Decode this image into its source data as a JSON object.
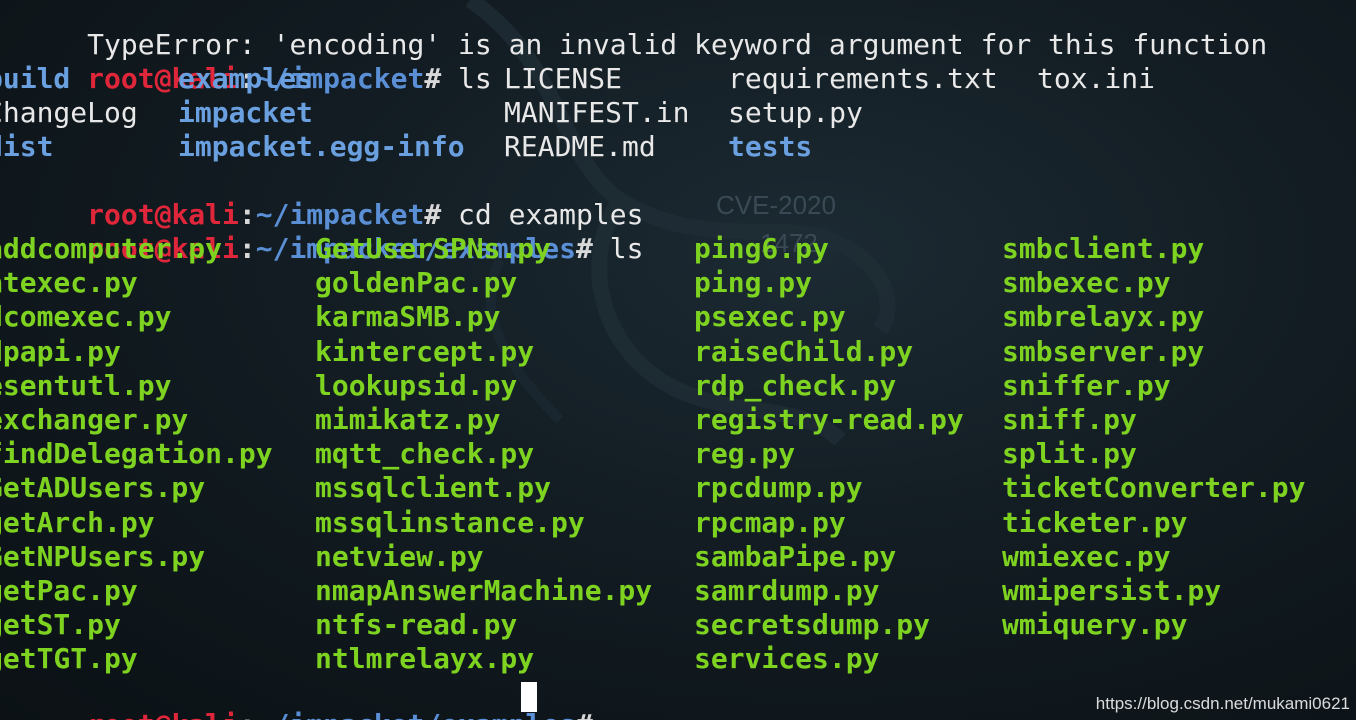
{
  "error_line": "TypeError: 'encoding' is an invalid keyword argument for this function",
  "prompt": {
    "user_host": "root@kali",
    "separator": ":",
    "path_home": "~/impacket",
    "path_examples": "~/impacket/examples",
    "symbol": "#"
  },
  "commands": {
    "ls1": " ls",
    "cd": " cd examples",
    "ls2": " ls"
  },
  "impacket_listing": [
    [
      {
        "text": "build",
        "type": "dir"
      },
      {
        "text": "examples",
        "type": "dir"
      },
      {
        "text": "LICENSE",
        "type": "file"
      },
      {
        "text": "requirements.txt",
        "type": "file"
      },
      {
        "text": "tox.ini",
        "type": "file"
      }
    ],
    [
      {
        "text": "ChangeLog",
        "type": "file"
      },
      {
        "text": "impacket",
        "type": "dir"
      },
      {
        "text": "MANIFEST.in",
        "type": "file"
      },
      {
        "text": "setup.py",
        "type": "file"
      }
    ],
    [
      {
        "text": "dist",
        "type": "dir"
      },
      {
        "text": "impacket.egg-info",
        "type": "dir"
      },
      {
        "text": "README.md",
        "type": "file"
      },
      {
        "text": "tests",
        "type": "dir"
      }
    ]
  ],
  "examples_listing": {
    "col1": [
      "addcomputer.py",
      "atexec.py",
      "dcomexec.py",
      "dpapi.py",
      "esentutl.py",
      "exchanger.py",
      "findDelegation.py",
      "GetADUsers.py",
      "getArch.py",
      "GetNPUsers.py",
      "getPac.py",
      "getST.py",
      "getTGT.py"
    ],
    "col2": [
      "GetUserSPNs.py",
      "goldenPac.py",
      "karmaSMB.py",
      "kintercept.py",
      "lookupsid.py",
      "mimikatz.py",
      "mqtt_check.py",
      "mssqlclient.py",
      "mssqlinstance.py",
      "netview.py",
      "nmapAnswerMachine.py",
      "ntfs-read.py",
      "ntlmrelayx.py"
    ],
    "col3": [
      "ping6.py",
      "ping.py",
      "psexec.py",
      "raiseChild.py",
      "rdp_check.py",
      "registry-read.py",
      "reg.py",
      "rpcdump.py",
      "rpcmap.py",
      "sambaPipe.py",
      "samrdump.py",
      "secretsdump.py",
      "services.py"
    ],
    "col4": [
      "smbclient.py",
      "smbexec.py",
      "smbrelayx.py",
      "smbserver.py",
      "sniffer.py",
      "sniff.py",
      "split.py",
      "ticketConverter.py",
      "ticketer.py",
      "wmiexec.py",
      "wmipersist.py",
      "wmiquery.py"
    ]
  },
  "background_text": [
    "CVE-2020",
    "1472"
  ],
  "watermark": "https://blog.csdn.net/mukami0621",
  "colors": {
    "prompt_user": "#e0263a",
    "prompt_path": "#5a8fd6",
    "directory": "#6aa0e0",
    "executable": "#7ed321",
    "plain": "#e8e8e8",
    "background": "#121c22"
  }
}
